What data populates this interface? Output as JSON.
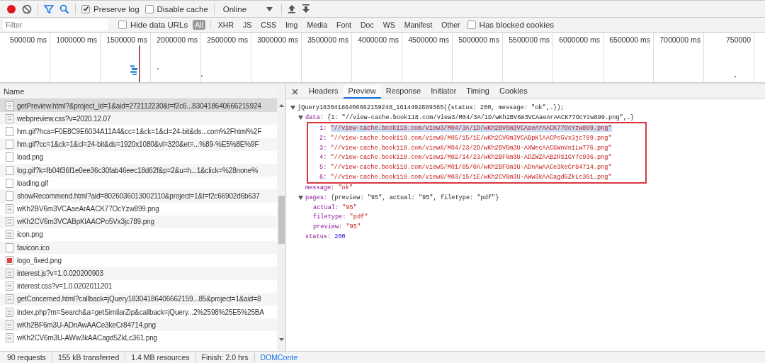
{
  "toolbar": {
    "recording": true,
    "filter_active": true,
    "checkboxes": [
      {
        "label": "Preserve log",
        "checked": true
      },
      {
        "label": "Disable cache",
        "checked": false
      }
    ],
    "throttling": "Online"
  },
  "filter_bar": {
    "placeholder": "Filter",
    "hide_data_urls": {
      "label": "Hide data URLs",
      "checked": false
    },
    "types": [
      {
        "label": "All",
        "selected": true
      },
      {
        "label": "XHR",
        "selected": false
      },
      {
        "label": "JS",
        "selected": false
      },
      {
        "label": "CSS",
        "selected": false
      },
      {
        "label": "Img",
        "selected": false
      },
      {
        "label": "Media",
        "selected": false
      },
      {
        "label": "Font",
        "selected": false
      },
      {
        "label": "Doc",
        "selected": false
      },
      {
        "label": "WS",
        "selected": false
      },
      {
        "label": "Manifest",
        "selected": false
      },
      {
        "label": "Other",
        "selected": false
      }
    ],
    "blocked_cookies": {
      "label": "Has blocked cookies",
      "checked": false
    }
  },
  "overview": {
    "ticks": [
      "500000 ms",
      "1000000 ms",
      "1500000 ms",
      "2000000 ms",
      "2500000 ms",
      "3000000 ms",
      "3500000 ms",
      "4000000 ms",
      "4500000 ms",
      "5000000 ms",
      "5500000 ms",
      "6000000 ms",
      "6500000 ms",
      "7000000 ms",
      "750000"
    ]
  },
  "requests": {
    "header": "Name",
    "rows": [
      {
        "name": "getPreview.html?&project_id=1&aid=272112230&t=f2c6...830418640666215924",
        "kind": "doc",
        "selected": true
      },
      {
        "name": "webpreview.css?v=2020.12.07",
        "kind": "doc",
        "selected": false
      },
      {
        "name": "hm.gif?hca=F0E8C9E6034A11A4&cc=1&ck=1&cl=24-bit&ds...com%2Fhtml%2F",
        "kind": "blank",
        "selected": false
      },
      {
        "name": "hm.gif?cc=1&ck=1&cl=24-bit&ds=1920x1080&vl=320&et=...%89-%E5%8E%9F",
        "kind": "blank",
        "selected": false
      },
      {
        "name": "load.png",
        "kind": "blank",
        "selected": false
      },
      {
        "name": "log.gif?k=fb04f36f1e0ee36c30fab46eec18d62f&p=2&u=h...1&click=%28none%",
        "kind": "blank",
        "selected": false
      },
      {
        "name": "loading.gif",
        "kind": "blank",
        "selected": false
      },
      {
        "name": "showRecommend.html?aid=8026036013002110&project=1&t=f2c66902d6b637",
        "kind": "blank",
        "selected": false
      },
      {
        "name": "wKh2BV6m3VCAaeArAACK77OcYzw899.png",
        "kind": "doc",
        "selected": false
      },
      {
        "name": "wKh2CV6m3VCABpKlAACPo5Vx3jc789.png",
        "kind": "doc",
        "selected": false
      },
      {
        "name": "icon.png",
        "kind": "doc",
        "selected": false
      },
      {
        "name": "favicon.ico",
        "kind": "blank",
        "selected": false
      },
      {
        "name": "logo_fixed.png",
        "kind": "image",
        "selected": false
      },
      {
        "name": "interest.js?v=1.0.020200903",
        "kind": "doc",
        "selected": false
      },
      {
        "name": "interest.css?v=1.0.0202011201",
        "kind": "doc",
        "selected": false
      },
      {
        "name": "getConcerned.html?callback=jQuery18304186406662159...85&project=1&aid=8",
        "kind": "doc",
        "selected": false
      },
      {
        "name": "index.php?m=Search&a=getSimilarZip&callback=jQuery...2%2598%25E5%25BA",
        "kind": "doc",
        "selected": false
      },
      {
        "name": "wKh2BF6m3U-ADnAwAACe3keCr84714.png",
        "kind": "doc",
        "selected": false
      },
      {
        "name": "wKh2CV6m3U-AWw3kAACagd5ZkLc361.png",
        "kind": "doc",
        "selected": false
      }
    ]
  },
  "detail_tabs": [
    {
      "label": "Headers",
      "selected": false
    },
    {
      "label": "Preview",
      "selected": true
    },
    {
      "label": "Response",
      "selected": false
    },
    {
      "label": "Initiator",
      "selected": false
    },
    {
      "label": "Timing",
      "selected": false
    },
    {
      "label": "Cookies",
      "selected": false
    }
  ],
  "preview": {
    "root": {
      "value": "jQuery18304186406662159248_1614492889385({status: 200, message: \"ok\",…});",
      "kind": "summary",
      "expanded": true,
      "children": [
        {
          "key": "data:",
          "value": "{1: \"//view-cache.book118.com/view3/M04/3A/1D/wKh2BV6m3VCAaeArAACK77OcYzw899.png\",…}",
          "kind": "summary",
          "expanded": true,
          "framed": true,
          "children": [
            {
              "key": "1:",
              "value": "\"//view-cache.book118.com/view3/M04/3A/1D/wKh2BV6m3VCAaeArAACK77OcYzw899.png\"",
              "kind": "string",
              "selected": true
            },
            {
              "key": "2:",
              "value": "\"//view-cache.book118.com/view8/M05/15/1E/wKh2CV6m3VCABpKlAACPo5Vx3jc789.png\"",
              "kind": "string",
              "selected": false
            },
            {
              "key": "3:",
              "value": "\"//view-cache.book118.com/view8/M04/23/2D/wKh2BV6m3U-AXWecAACGWnVn1Lw776.png\"",
              "kind": "string",
              "selected": false
            },
            {
              "key": "4:",
              "value": "\"//view-cache.book118.com/view1/M02/14/23/wKh2BF6m3U-ADZWZAAB2RS1GY7c936.png\"",
              "kind": "string",
              "selected": false
            },
            {
              "key": "5:",
              "value": "\"//view-cache.book118.com/view5/M01/05/0A/wKh2BF6m3U-ADnAwAACe3keCr84714.png\"",
              "kind": "string",
              "selected": false
            },
            {
              "key": "6:",
              "value": "\"//view-cache.book118.com/view8/M03/15/1E/wKh2CV6m3U-AWw3kAACagd5ZkLc361.png\"",
              "kind": "string",
              "selected": false
            }
          ]
        },
        {
          "key": "message:",
          "value": "\"ok\"",
          "kind": "string"
        },
        {
          "key": "pages:",
          "value": "{preview: \"95\", actual: \"95\", filetype: \"pdf\"}",
          "kind": "summary",
          "expanded": true,
          "children": [
            {
              "key": "actual:",
              "value": "\"95\"",
              "kind": "string"
            },
            {
              "key": "filetype:",
              "value": "\"pdf\"",
              "kind": "string"
            },
            {
              "key": "preview:",
              "value": "\"95\"",
              "kind": "string"
            }
          ]
        },
        {
          "key": "status:",
          "value": "200",
          "kind": "number"
        }
      ]
    }
  },
  "status_bar": [
    {
      "text": "90 requests",
      "kind": "text"
    },
    {
      "text": "155 kB transferred",
      "kind": "text"
    },
    {
      "text": "1.4 MB resources",
      "kind": "text"
    },
    {
      "text": "Finish: 2.0 hrs",
      "kind": "text"
    },
    {
      "text": "DOMConte",
      "kind": "link"
    }
  ]
}
